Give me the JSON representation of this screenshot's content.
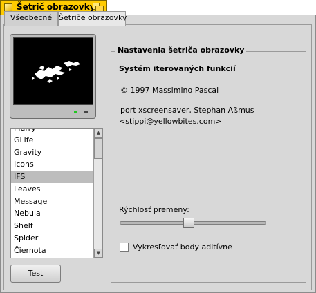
{
  "window": {
    "title": "Šetrič obrazovky"
  },
  "tabs": [
    {
      "label": "Všeobecné",
      "active": false
    },
    {
      "label": "Šetriče obrazovky",
      "active": true
    }
  ],
  "screensavers": {
    "items": [
      "Flurry",
      "GLife",
      "Gravity",
      "Icons",
      "IFS",
      "Leaves",
      "Message",
      "Nebula",
      "Shelf",
      "Spider",
      "Čiernota"
    ],
    "selected": "IFS"
  },
  "test_button": {
    "label": "Test"
  },
  "settings": {
    "group_title": "Nastavenia šetriča obrazovky",
    "name": "Systém iterovaných funkcií",
    "copyright": "© 1997 Massimino Pascal",
    "port_line1": "port xscreensaver, Stephan Aßmus",
    "port_line2": "<stippi@yellowbites.com>",
    "speed_label": "Rýchlosť premeny:",
    "speed_value": 0.47,
    "additive_label": "Vykresľovať body aditívne",
    "additive_checked": false
  },
  "colors": {
    "tab_yellow": "#ffcb00",
    "panel": "#d8d8d8",
    "selection": "#bdbdbd"
  }
}
